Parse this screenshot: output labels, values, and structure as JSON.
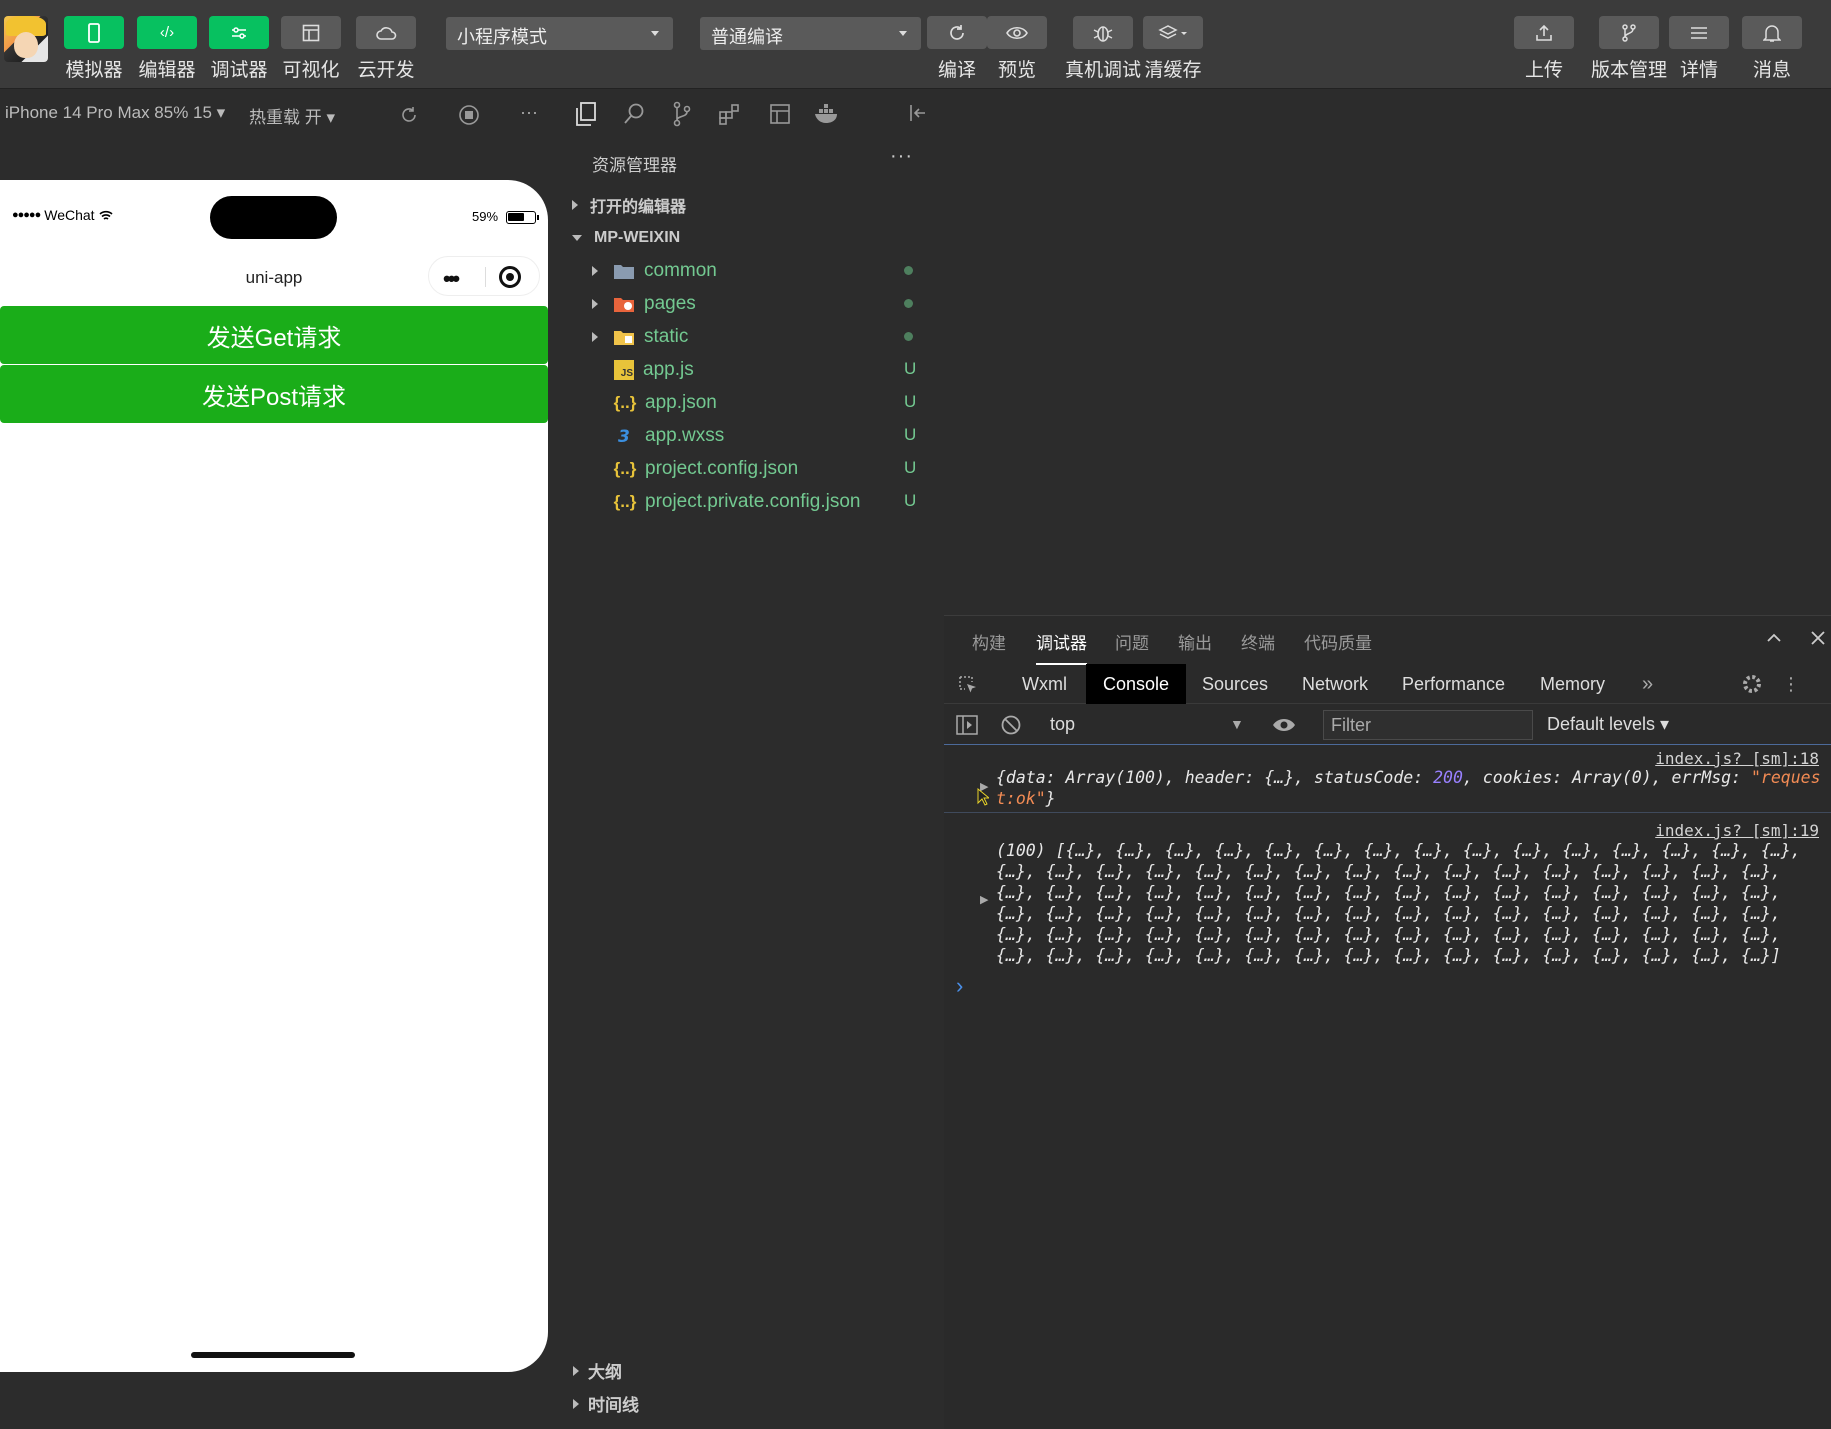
{
  "toolbar": {
    "simulator": "模拟器",
    "editor": "编辑器",
    "debugger": "调试器",
    "visual": "可视化",
    "cloud": "云开发",
    "mode_select": "小程序模式",
    "compile_select": "普通编译",
    "compile": "编译",
    "preview": "预览",
    "remote_debug": "真机调试",
    "clear_cache": "清缓存",
    "upload": "上传",
    "version": "版本管理",
    "details": "详情",
    "messages": "消息"
  },
  "subbar": {
    "device": "iPhone 14 Pro Max 85% 15 ▾",
    "hot_reload": "热重载 开 ▾"
  },
  "phone": {
    "carrier": "WeChat",
    "battery": "59%",
    "nav_title": "uni-app",
    "btn_get": "发送Get请求",
    "btn_post": "发送Post请求"
  },
  "explorer": {
    "title": "资源管理器",
    "more": "···",
    "open_editors": "打开的编辑器",
    "project": "MP-WEIXIN",
    "items": [
      {
        "name": "common",
        "type": "folder",
        "status": "dot"
      },
      {
        "name": "pages",
        "type": "folder-pages",
        "status": "dot"
      },
      {
        "name": "static",
        "type": "folder-static",
        "status": "dot"
      },
      {
        "name": "app.js",
        "type": "js",
        "status": "U"
      },
      {
        "name": "app.json",
        "type": "json",
        "status": "U"
      },
      {
        "name": "app.wxss",
        "type": "css",
        "status": "U"
      },
      {
        "name": "project.config.json",
        "type": "json",
        "status": "U"
      },
      {
        "name": "project.private.config.json",
        "type": "json",
        "status": "U"
      }
    ],
    "outline": "大纲",
    "timeline": "时间线"
  },
  "devtools": {
    "top_tabs": [
      "构建",
      "调试器",
      "问题",
      "输出",
      "终端",
      "代码质量"
    ],
    "active_top_tab": "调试器",
    "panel_tabs": [
      "Wxml",
      "Console",
      "Sources",
      "Network",
      "Performance",
      "Memory"
    ],
    "active_panel_tab": "Console",
    "more_tabs": "»",
    "context": "top",
    "filter_placeholder": "Filter",
    "levels": "Default levels ▾",
    "logs": [
      {
        "source": "index.js? [sm]:18",
        "line1_a": "{data: Array(100), header: {…}, statusCode: ",
        "status_code": "200",
        "line1_b": ", cookies: Array(0), errMsg: ",
        "errmsg_1": "\"reques",
        "errmsg_2": "t:ok\"",
        "line2_end": "}"
      },
      {
        "source": "index.js? [sm]:19",
        "lines": [
          "(100) [{…}, {…}, {…}, {…}, {…}, {…}, {…}, {…}, {…}, {…}, {…}, {…}, {…}, {…}, {…},",
          "{…}, {…}, {…}, {…}, {…}, {…}, {…}, {…}, {…}, {…}, {…}, {…}, {…}, {…}, {…}, {…},",
          "{…}, {…}, {…}, {…}, {…}, {…}, {…}, {…}, {…}, {…}, {…}, {…}, {…}, {…}, {…}, {…},",
          "{…}, {…}, {…}, {…}, {…}, {…}, {…}, {…}, {…}, {…}, {…}, {…}, {…}, {…}, {…}, {…},",
          "{…}, {…}, {…}, {…}, {…}, {…}, {…}, {…}, {…}, {…}, {…}, {…}, {…}, {…}, {…}, {…},",
          "{…}, {…}, {…}, {…}, {…}, {…}, {…}, {…}, {…}, {…}, {…}, {…}, {…}, {…}, {…}, {…}]"
        ]
      }
    ],
    "prompt": "›"
  },
  "colors": {
    "accent_green": "#07c160",
    "button_green": "#1aad19",
    "file_green": "#73c991"
  }
}
